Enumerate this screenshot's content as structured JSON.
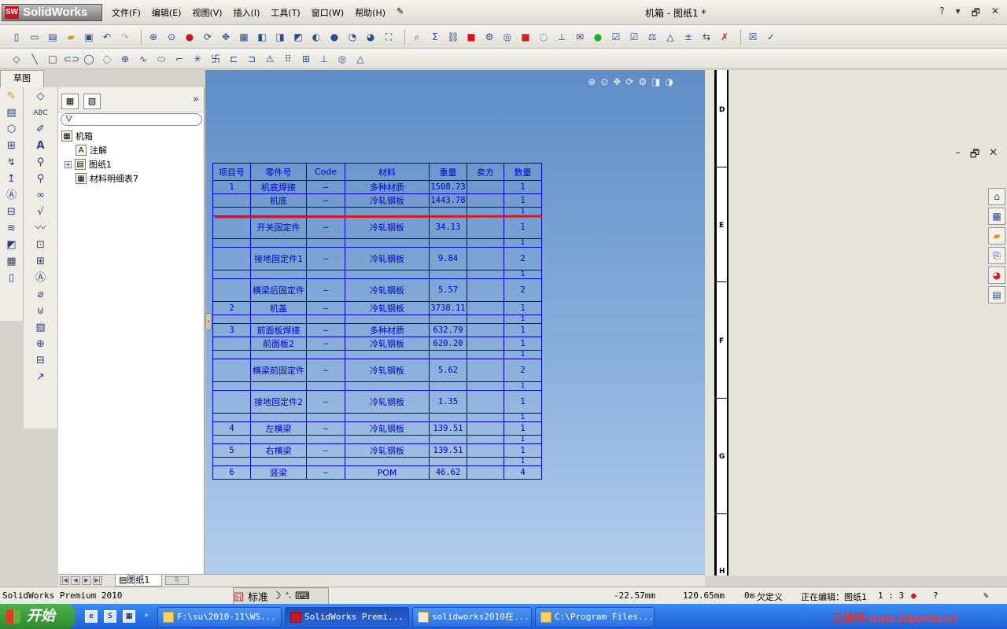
{
  "app": {
    "logo": "SolidWorks",
    "logo_badge": "SW",
    "document_title": "机箱 - 图纸1 *",
    "menu": [
      "文件(F)",
      "编辑(E)",
      "视图(V)",
      "插入(I)",
      "工具(T)",
      "窗口(W)",
      "帮助(H)"
    ],
    "window_controls": [
      "?",
      "▾",
      "🗗",
      "✕"
    ]
  },
  "left_tab": "草图",
  "feature_tree": {
    "root": "机箱",
    "items": [
      "注解",
      "图纸1",
      "材料明细表7"
    ]
  },
  "bom": {
    "headers": [
      "项目号",
      "零件号",
      "Code",
      "材料",
      "重量",
      "卖方",
      "数量"
    ],
    "rows": [
      [
        "1",
        "机底焊接",
        "–",
        "多种材质",
        "1508.73",
        "",
        "1"
      ],
      [
        "",
        "机底",
        "–",
        "冷轧钢板",
        "1443.78",
        "",
        "1"
      ],
      [
        "",
        "",
        "",
        "",
        "",
        "",
        "1"
      ],
      [
        "",
        "开关固定件",
        "–",
        "冷轧钢板",
        "34.13",
        "",
        "1"
      ],
      [
        "",
        "",
        "",
        "",
        "",
        "",
        "1"
      ],
      [
        "",
        "接地固定件1",
        "–",
        "冷轧钢板",
        "9.84",
        "",
        "2"
      ],
      [
        "",
        "",
        "",
        "",
        "",
        "",
        "1"
      ],
      [
        "",
        "横梁后固定件",
        "–",
        "冷轧钢板",
        "5.57",
        "",
        "2"
      ],
      [
        "2",
        "机盖",
        "–",
        "冷轧钢板",
        "3738.11",
        "",
        "1"
      ],
      [
        "",
        "",
        "",
        "",
        "",
        "",
        "1"
      ],
      [
        "3",
        "前面板焊接",
        "–",
        "多种材质",
        "632.79",
        "",
        "1"
      ],
      [
        "",
        "前面板2",
        "–",
        "冷轧钢板",
        "620.20",
        "",
        "1"
      ],
      [
        "",
        "",
        "",
        "",
        "",
        "",
        "1"
      ],
      [
        "",
        "横梁前固定件",
        "–",
        "冷轧钢板",
        "5.62",
        "",
        "2"
      ],
      [
        "",
        "",
        "",
        "",
        "",
        "",
        "1"
      ],
      [
        "",
        "接地固定件2",
        "–",
        "冷轧钢板",
        "1.35",
        "",
        "1"
      ],
      [
        "",
        "",
        "",
        "",
        "",
        "",
        "1"
      ],
      [
        "4",
        "左横梁",
        "–",
        "冷轧钢板",
        "139.51",
        "",
        "1"
      ],
      [
        "",
        "",
        "",
        "",
        "",
        "",
        "1"
      ],
      [
        "5",
        "右横梁",
        "–",
        "冷轧钢板",
        "139.51",
        "",
        "1"
      ],
      [
        "",
        "",
        "",
        "",
        "",
        "",
        "1"
      ],
      [
        "6",
        "竖梁",
        "–",
        "POM",
        "46.62",
        "",
        "4"
      ]
    ]
  },
  "sheet_zones": [
    "D",
    "E",
    "F",
    "G",
    "H"
  ],
  "sheet_tab": "图纸1",
  "status": {
    "app_name": "SolidWorks Premium 2010",
    "ime_mode": "标准",
    "x": "-22.57mm",
    "y": "120.65mm",
    "z": "0m",
    "definition": "欠定义",
    "editing": "正在编辑：图纸1",
    "scale": "1 : 3"
  },
  "taskbar": {
    "start": "开始",
    "buttons": [
      "F:\\su\\2010-11\\WS...",
      "SolidWorks Premi...",
      "solidworks2010在...",
      "C:\\Program Files..."
    ],
    "watermark_cn": "三维网",
    "watermark_site": "www.3dportal.cn"
  },
  "colors": {
    "bom_line": "#0000cc",
    "annotation_red": "#e01515",
    "graphics_top": "#5f8dc6",
    "graphics_bottom": "#b3cdee"
  }
}
